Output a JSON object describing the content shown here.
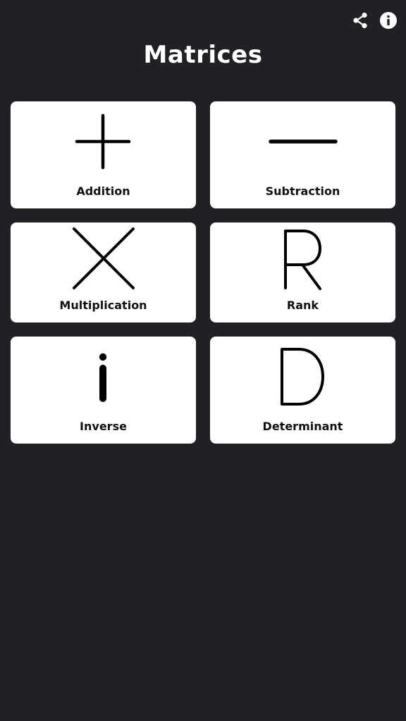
{
  "header": {
    "title": "Matrices",
    "actions": [
      {
        "icon": "share-icon"
      },
      {
        "icon": "info-icon"
      }
    ]
  },
  "colors": {
    "background": "#202124",
    "card": "#ffffff",
    "text": "#111111",
    "title": "#ffffff"
  },
  "cards": [
    {
      "label": "Addition",
      "icon": "plus-icon"
    },
    {
      "label": "Subtraction",
      "icon": "minus-icon"
    },
    {
      "label": "Multiplication",
      "icon": "multiply-icon"
    },
    {
      "label": "Rank",
      "icon": "rank-r-icon"
    },
    {
      "label": "Inverse",
      "icon": "inverse-i-icon"
    },
    {
      "label": "Determinant",
      "icon": "determinant-d-icon"
    }
  ]
}
